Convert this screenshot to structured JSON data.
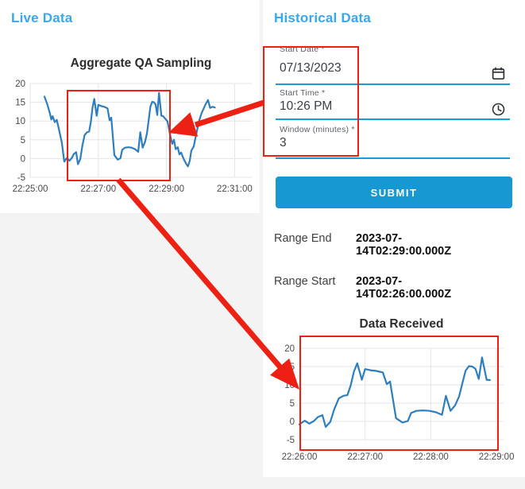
{
  "live_panel": {
    "heading": "Live Data"
  },
  "historical_panel": {
    "heading": "Historical Data",
    "form": {
      "fields": [
        {
          "label": "Start Date *",
          "value": "07/13/2023",
          "icon": "calendar-icon"
        },
        {
          "label": "Start Time *",
          "value": "10:26 PM",
          "icon": "clock-icon"
        },
        {
          "label": "Window (minutes) *",
          "value": "3",
          "icon": null
        }
      ],
      "submit_label": "SUBMIT"
    },
    "results": {
      "range_end_label": "Range End",
      "range_end_value": "2023-07-14T02:29:00.000Z",
      "range_start_label": "Range Start",
      "range_start_value": "2023-07-14T02:26:00.000Z"
    }
  },
  "theme": {
    "accent_blue": "#38a7ee",
    "button_blue": "#1798d2",
    "underline_blue": "#1c9ad6",
    "line_blue": "#2e7dbc",
    "annotation_red": "#ec2113",
    "grid_gray": "#e5e5e5"
  },
  "chart_data": [
    {
      "id": "live",
      "type": "line",
      "title": "Aggregate QA Sampling",
      "xlabel": "",
      "ylabel": "",
      "x_tick_labels": [
        "22:25:00",
        "22:27:00",
        "22:29:00",
        "22:31:00"
      ],
      "x_tick_pos_min": [
        0,
        2,
        4,
        6
      ],
      "y_ticks": [
        "20",
        "15",
        "10",
        "5",
        "0",
        "-5"
      ],
      "ylim": [
        -5,
        20
      ],
      "xlim_min": [
        0,
        6.5
      ],
      "grid": true,
      "legend": false,
      "series_name": "Aggregate QA Sampling",
      "points": [
        [
          0.42,
          16.5
        ],
        [
          0.5,
          14.5
        ],
        [
          0.58,
          12.0
        ],
        [
          0.62,
          10.4
        ],
        [
          0.66,
          11.3
        ],
        [
          0.72,
          9.7
        ],
        [
          0.78,
          10.3
        ],
        [
          0.85,
          7.5
        ],
        [
          0.93,
          4.2
        ],
        [
          1.0,
          -0.8
        ],
        [
          1.08,
          0.2
        ],
        [
          1.15,
          -0.6
        ],
        [
          1.22,
          0.1
        ],
        [
          1.28,
          1.2
        ],
        [
          1.35,
          1.7
        ],
        [
          1.4,
          -1.5
        ],
        [
          1.47,
          -0.1
        ],
        [
          1.53,
          3.3
        ],
        [
          1.6,
          6.3
        ],
        [
          1.67,
          7.0
        ],
        [
          1.73,
          7.2
        ],
        [
          1.78,
          9.8
        ],
        [
          1.83,
          13.6
        ],
        [
          1.88,
          15.9
        ],
        [
          1.95,
          11.4
        ],
        [
          2.0,
          14.3
        ],
        [
          2.08,
          14.0
        ],
        [
          2.17,
          13.8
        ],
        [
          2.27,
          13.4
        ],
        [
          2.33,
          10.2
        ],
        [
          2.38,
          10.9
        ],
        [
          2.47,
          0.9
        ],
        [
          2.57,
          -0.3
        ],
        [
          2.65,
          0.1
        ],
        [
          2.7,
          2.3
        ],
        [
          2.78,
          2.9
        ],
        [
          2.88,
          3.0
        ],
        [
          2.98,
          2.9
        ],
        [
          3.08,
          2.5
        ],
        [
          3.17,
          1.8
        ],
        [
          3.23,
          7.0
        ],
        [
          3.3,
          2.9
        ],
        [
          3.37,
          4.4
        ],
        [
          3.43,
          6.8
        ],
        [
          3.48,
          10.4
        ],
        [
          3.53,
          13.9
        ],
        [
          3.58,
          15.1
        ],
        [
          3.63,
          15.0
        ],
        [
          3.68,
          14.4
        ],
        [
          3.73,
          11.6
        ],
        [
          3.78,
          17.5
        ],
        [
          3.85,
          11.4
        ],
        [
          3.9,
          11.3
        ],
        [
          4.03,
          9.9
        ],
        [
          4.12,
          5.8
        ],
        [
          4.17,
          3.9
        ],
        [
          4.22,
          5.0
        ],
        [
          4.27,
          2.5
        ],
        [
          4.33,
          3.0
        ],
        [
          4.38,
          1.1
        ],
        [
          4.43,
          1.6
        ],
        [
          4.5,
          0.0
        ],
        [
          4.57,
          -1.3
        ],
        [
          4.63,
          -2.1
        ],
        [
          4.68,
          -0.7
        ],
        [
          4.73,
          2.1
        ],
        [
          4.8,
          3.2
        ],
        [
          4.85,
          5.5
        ],
        [
          4.92,
          8.5
        ],
        [
          4.97,
          10.4
        ],
        [
          5.03,
          12.1
        ],
        [
          5.1,
          13.5
        ],
        [
          5.15,
          14.5
        ],
        [
          5.22,
          15.6
        ],
        [
          5.28,
          13.5
        ],
        [
          5.35,
          13.8
        ],
        [
          5.42,
          13.6
        ]
      ]
    },
    {
      "id": "received",
      "type": "line",
      "title": "Data Received",
      "xlabel": "",
      "ylabel": "",
      "x_tick_labels": [
        "22:26:00",
        "22:27:00",
        "22:28:00",
        "22:29:00"
      ],
      "x_tick_pos_min": [
        0,
        1,
        2,
        3
      ],
      "y_ticks": [
        "20",
        "15",
        "10",
        "5",
        "0",
        "-5"
      ],
      "ylim": [
        -5,
        20
      ],
      "xlim_min": [
        0,
        3.1
      ],
      "grid": true,
      "legend": false,
      "series_name": "Data Received",
      "points": [
        [
          0.0,
          -0.8
        ],
        [
          0.08,
          0.2
        ],
        [
          0.15,
          -0.6
        ],
        [
          0.22,
          0.1
        ],
        [
          0.28,
          1.2
        ],
        [
          0.35,
          1.7
        ],
        [
          0.4,
          -1.5
        ],
        [
          0.47,
          -0.1
        ],
        [
          0.53,
          3.3
        ],
        [
          0.6,
          6.3
        ],
        [
          0.67,
          7.0
        ],
        [
          0.73,
          7.2
        ],
        [
          0.78,
          9.8
        ],
        [
          0.83,
          13.6
        ],
        [
          0.88,
          15.9
        ],
        [
          0.95,
          11.4
        ],
        [
          1.0,
          14.3
        ],
        [
          1.08,
          14.0
        ],
        [
          1.17,
          13.8
        ],
        [
          1.27,
          13.4
        ],
        [
          1.33,
          10.2
        ],
        [
          1.38,
          10.9
        ],
        [
          1.47,
          0.9
        ],
        [
          1.57,
          -0.3
        ],
        [
          1.65,
          0.1
        ],
        [
          1.7,
          2.3
        ],
        [
          1.78,
          2.9
        ],
        [
          1.88,
          3.0
        ],
        [
          1.98,
          2.9
        ],
        [
          2.08,
          2.5
        ],
        [
          2.17,
          1.8
        ],
        [
          2.23,
          7.0
        ],
        [
          2.3,
          2.9
        ],
        [
          2.37,
          4.4
        ],
        [
          2.43,
          6.8
        ],
        [
          2.48,
          10.4
        ],
        [
          2.53,
          13.9
        ],
        [
          2.58,
          15.1
        ],
        [
          2.63,
          15.0
        ],
        [
          2.68,
          14.4
        ],
        [
          2.73,
          11.6
        ],
        [
          2.78,
          17.5
        ],
        [
          2.85,
          11.4
        ],
        [
          2.9,
          11.3
        ]
      ]
    }
  ]
}
